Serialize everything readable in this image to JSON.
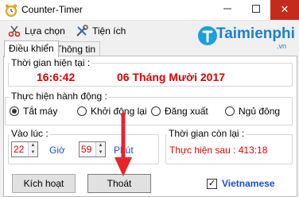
{
  "window": {
    "title": "Counter-Timer",
    "close_glyph": "✕"
  },
  "menu": {
    "items": [
      {
        "label": "Lựa chọn",
        "icon": "scissors-icon"
      },
      {
        "label": "Tiện ích",
        "icon": "tools-icon"
      }
    ]
  },
  "tabs": [
    {
      "label": "Điều khiển"
    },
    {
      "label": "Thông tin"
    }
  ],
  "current_time": {
    "label": "Thời gian hiện tại :",
    "time": "16:6:42",
    "date": "06 Tháng Mười 2017"
  },
  "action": {
    "label": "Thực hiện hành động :",
    "options": [
      {
        "label": "Tắt máy",
        "selected": true
      },
      {
        "label": "Khởi động lại",
        "selected": false
      },
      {
        "label": "Đăng xuất",
        "selected": false
      },
      {
        "label": "Ngủ đông",
        "selected": false
      }
    ]
  },
  "at_time": {
    "label": "Vào lúc :",
    "hour": "22",
    "hour_unit": "Giờ",
    "minute": "59",
    "minute_unit": "Phút"
  },
  "remaining": {
    "label": "Thời gian còn lại :",
    "text": "Thực hiện sau : 413:18"
  },
  "buttons": {
    "activate": "Kích hoạt",
    "exit": "Thoát"
  },
  "language": {
    "label": "Vietnamese",
    "checked": true
  },
  "watermark": {
    "text": "Taimienphi",
    "suffix": ".vn"
  },
  "colors": {
    "accent_red": "#e00000",
    "link_blue": "#1a4fd0"
  }
}
